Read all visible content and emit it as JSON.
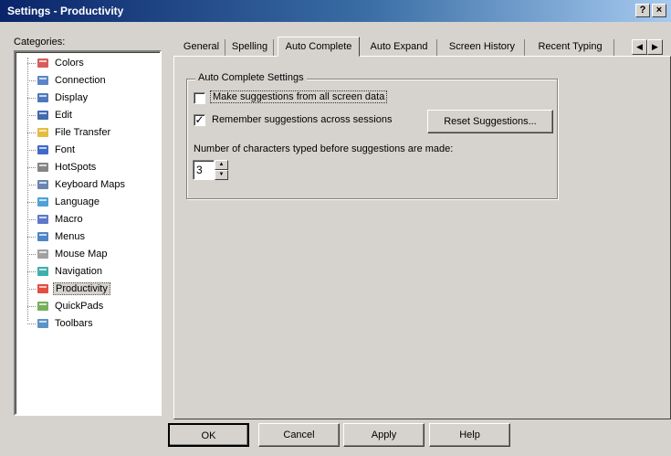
{
  "window": {
    "title": "Settings - Productivity",
    "help_btn": "?",
    "close_btn": "×"
  },
  "categories": {
    "label": "Categories:",
    "items": [
      {
        "label": "Colors",
        "icon": "colors-icon"
      },
      {
        "label": "Connection",
        "icon": "connection-icon"
      },
      {
        "label": "Display",
        "icon": "display-icon"
      },
      {
        "label": "Edit",
        "icon": "edit-icon"
      },
      {
        "label": "File Transfer",
        "icon": "file-transfer-icon"
      },
      {
        "label": "Font",
        "icon": "font-icon"
      },
      {
        "label": "HotSpots",
        "icon": "hotspots-icon"
      },
      {
        "label": "Keyboard Maps",
        "icon": "keyboard-icon"
      },
      {
        "label": "Language",
        "icon": "language-icon"
      },
      {
        "label": "Macro",
        "icon": "macro-icon"
      },
      {
        "label": "Menus",
        "icon": "menus-icon"
      },
      {
        "label": "Mouse Map",
        "icon": "mouse-icon"
      },
      {
        "label": "Navigation",
        "icon": "navigation-icon"
      },
      {
        "label": "Productivity",
        "icon": "productivity-icon",
        "selected": true
      },
      {
        "label": "QuickPads",
        "icon": "quickpads-icon"
      },
      {
        "label": "Toolbars",
        "icon": "toolbars-icon"
      }
    ]
  },
  "tabs": [
    {
      "label": "General"
    },
    {
      "label": "Spelling"
    },
    {
      "label": "Auto Complete",
      "active": true
    },
    {
      "label": "Auto Expand"
    },
    {
      "label": "Screen History"
    },
    {
      "label": "Recent Typing"
    }
  ],
  "auto_complete": {
    "group_title": "Auto Complete Settings",
    "make_suggestions": {
      "label": "Make suggestions from all screen data",
      "checked": false
    },
    "remember_suggestions": {
      "label": "Remember suggestions across sessions",
      "checked": true
    },
    "reset_button": "Reset Suggestions...",
    "chars_label": "Number of characters typed before suggestions are made:",
    "chars_value": "3"
  },
  "footer": {
    "ok": "OK",
    "cancel": "Cancel",
    "apply": "Apply",
    "help": "Help"
  }
}
